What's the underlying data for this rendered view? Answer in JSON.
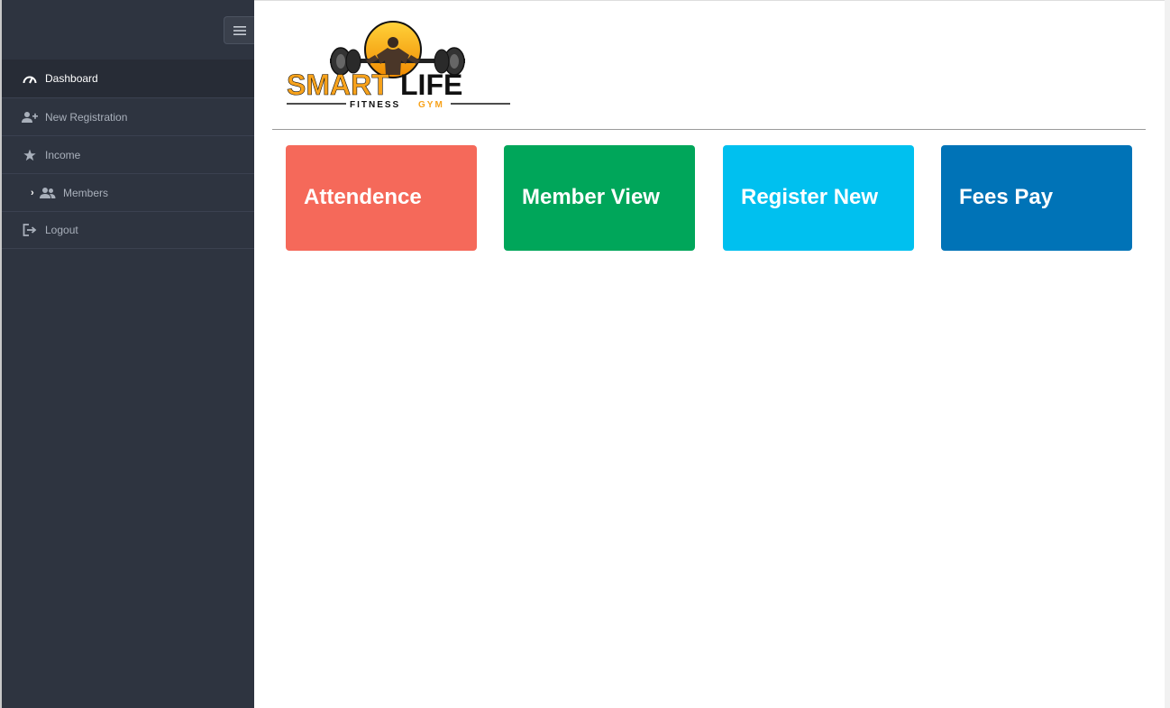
{
  "sidebar": {
    "toggle_icon": "hamburger-icon",
    "items": [
      {
        "label": "Dashboard",
        "icon": "dashboard-icon",
        "active": true
      },
      {
        "label": "New Registration",
        "icon": "user-plus-icon"
      },
      {
        "label": "Income",
        "icon": "star-icon"
      },
      {
        "label": "Members",
        "icon": "users-icon",
        "chevron": "›"
      },
      {
        "label": "Logout",
        "icon": "sign-out-icon"
      }
    ]
  },
  "logo": {
    "word_left": "SMART",
    "word_right": "LIFE",
    "tagline_a": "FITNESS",
    "tagline_b": "GYM"
  },
  "tiles": [
    {
      "label": "Attendence",
      "color": "#f5695a"
    },
    {
      "label": "Member View",
      "color": "#00a65a"
    },
    {
      "label": "Register New",
      "color": "#00c0ef"
    },
    {
      "label": "Fees Pay",
      "color": "#0073b7"
    }
  ],
  "colors": {
    "sidebar_bg": "#2e3440",
    "sidebar_active": "#272c36",
    "brand_orange": "#f7a21b"
  }
}
